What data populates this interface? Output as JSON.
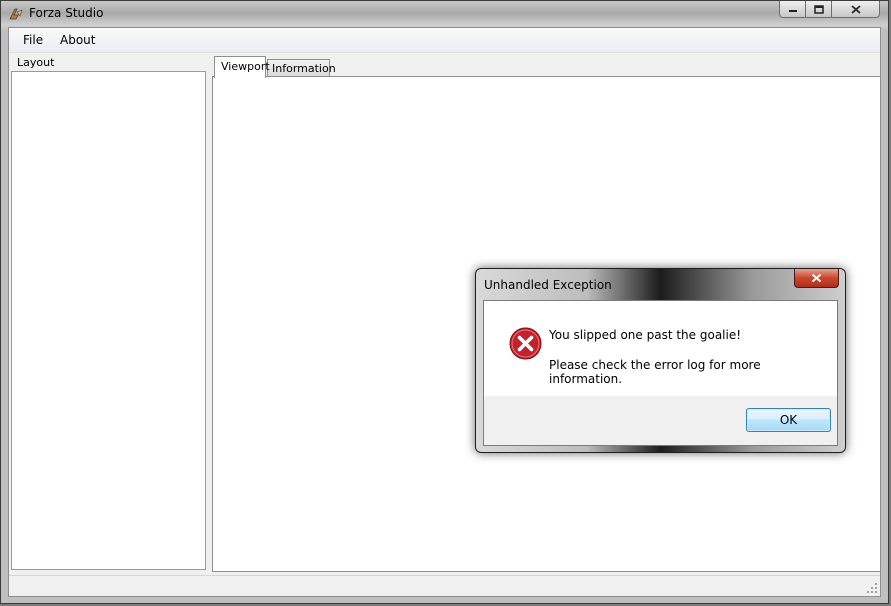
{
  "window": {
    "title": "Forza Studio",
    "icon": "forza-logo-icon",
    "caption_buttons": [
      "minimize-icon",
      "maximize-icon",
      "close-icon"
    ]
  },
  "menu": {
    "items": [
      {
        "label": "File"
      },
      {
        "label": "About"
      }
    ]
  },
  "layout_panel": {
    "label": "Layout"
  },
  "tabs": [
    {
      "label": "Viewport",
      "active": true
    },
    {
      "label": "Information",
      "active": false
    }
  ],
  "dialog": {
    "title": "Unhandled Exception",
    "icon": "error-icon",
    "message": "You slipped one past the goalie!",
    "detail": "Please check the error log for more information.",
    "ok_label": "OK",
    "colors": {
      "error": "#c3212b",
      "close_button": "#c9472f",
      "ok_border": "#3c7fb1"
    }
  }
}
